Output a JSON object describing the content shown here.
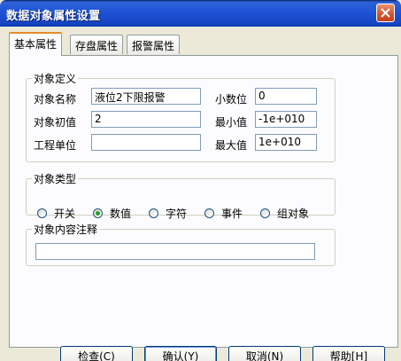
{
  "window": {
    "title": "数据对象属性设置"
  },
  "tabs": [
    {
      "label": "基本属性",
      "active": true
    },
    {
      "label": "存盘属性",
      "active": false
    },
    {
      "label": "报警属性",
      "active": false
    }
  ],
  "object_definition": {
    "legend": "对象定义",
    "name_label": "对象名称",
    "name_value": "液位2下限报警",
    "initial_label": "对象初值",
    "initial_value": "2",
    "unit_label": "工程单位",
    "unit_value": "",
    "decimals_label": "小数位",
    "decimals_value": "0",
    "min_label": "最小值",
    "min_value": "-1e+010",
    "max_label": "最大值",
    "max_value": "1e+010"
  },
  "object_type": {
    "legend": "对象类型",
    "options": [
      {
        "label": "开关",
        "selected": false
      },
      {
        "label": "数值",
        "selected": true
      },
      {
        "label": "字符",
        "selected": false
      },
      {
        "label": "事件",
        "selected": false
      },
      {
        "label": "组对象",
        "selected": false
      }
    ]
  },
  "comment": {
    "legend": "对象内容注释",
    "value": ""
  },
  "buttons": {
    "check": "检查(C)",
    "ok": "确认(Y)",
    "cancel": "取消(N)",
    "help": "帮助[H]"
  },
  "colors": {
    "title_bar": "#1f55d6",
    "active_tab_accent": "#e68b2c",
    "radio_dot": "#21a121"
  }
}
